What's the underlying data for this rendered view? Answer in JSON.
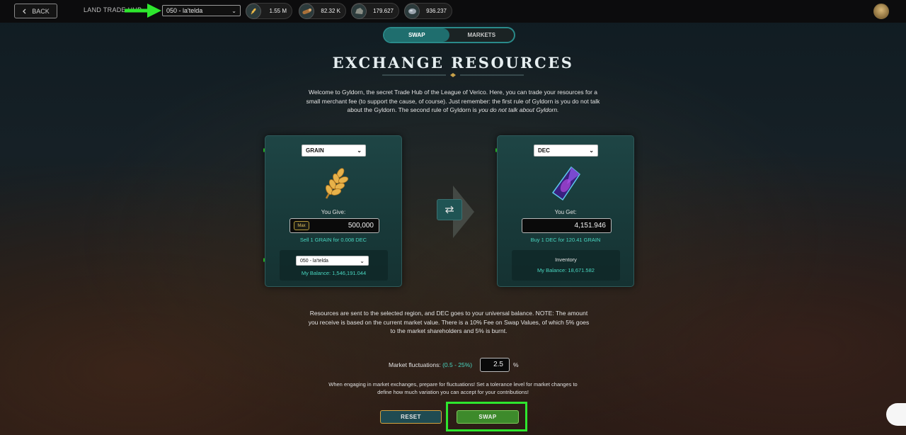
{
  "topbar": {
    "back_label": "BACK",
    "hub_label": "LAND TRADE HUB",
    "hub_selected": "050 - la'telda",
    "resources": [
      {
        "icon": "grain-icon",
        "value": "1.55 M"
      },
      {
        "icon": "wood-icon",
        "value": "82.32 K"
      },
      {
        "icon": "stone-icon",
        "value": "179.627"
      },
      {
        "icon": "iron-icon",
        "value": "936.237"
      }
    ]
  },
  "tabs": [
    {
      "label": "SWAP",
      "active": true
    },
    {
      "label": "MARKETS",
      "active": false
    }
  ],
  "title": "EXCHANGE RESOURCES",
  "intro": {
    "text": "Welcome to Gyldorn, the secret Trade Hub of the League of Verico. Here, you can trade your resources for a small merchant fee (to support the cause, of course). Just remember: the first rule of Gyldorn is you do not talk about the Gyldorn. The second rule of Gyldorn is ",
    "emphasis": "you do not talk about Gyldorn."
  },
  "give_panel": {
    "resource": "GRAIN",
    "label": "You Give:",
    "max_label": "Max",
    "amount": "500,000",
    "rate": "Sell 1 GRAIN for 0.008 DEC",
    "region": "050 - la'telda",
    "balance": "My Balance: 1,546,191.044"
  },
  "get_panel": {
    "resource": "DEC",
    "label": "You Get:",
    "amount": "4,151.946",
    "rate": "Buy 1 DEC for 120.41 GRAIN",
    "inventory_label": "Inventory",
    "balance": "My Balance: 18,671.582"
  },
  "note": "Resources are sent to the selected region, and DEC goes to your universal balance. NOTE: The amount you receive is based on the current market value. There is a 10% Fee on Swap Values, of which 5% goes to the market shareholders and 5% is burnt.",
  "fluctuation": {
    "label": "Market fluctuations:",
    "range": "(0.5 - 25%)",
    "value": "2.5",
    "unit": "%"
  },
  "warning": "When engaging in market exchanges, prepare for fluctuations! Set a tolerance level for market changes to define how much variation you can accept for your contributions!",
  "buttons": {
    "reset": "RESET",
    "swap": "SWAP"
  },
  "colors": {
    "accent": "#2a8a8a",
    "highlight": "#2ee62e",
    "swap_button": "#3d8a2b",
    "rate_text": "#49d6c0"
  }
}
